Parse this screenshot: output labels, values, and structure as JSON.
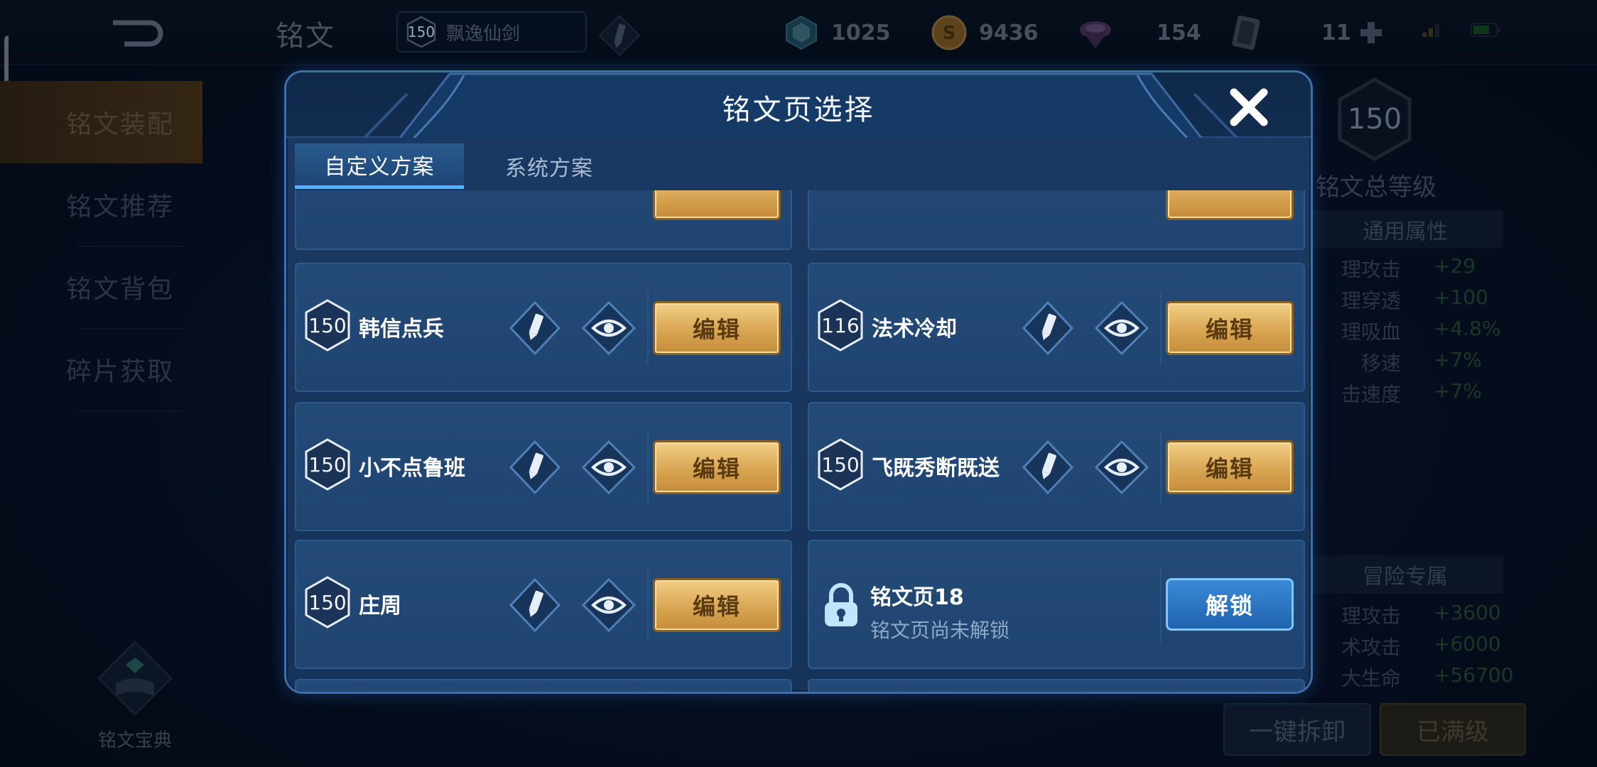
{
  "app": {
    "page_title": "铭文",
    "hero_level": "150",
    "hero_name": "飘逸仙剑",
    "currencies": [
      {
        "name": "diamond",
        "icon": "diamond-icon",
        "value": "1025"
      },
      {
        "name": "gold",
        "icon": "gold-coin-icon",
        "value": "9436"
      },
      {
        "name": "crystal",
        "icon": "crystal-icon",
        "value": "154"
      },
      {
        "name": "card",
        "icon": "card-icon",
        "value": "11"
      }
    ]
  },
  "sidebar": {
    "items": [
      {
        "label": "铭文装配",
        "active": true
      },
      {
        "label": "铭文推荐",
        "active": false
      },
      {
        "label": "铭文背包",
        "active": false
      },
      {
        "label": "碎片获取",
        "active": false
      }
    ],
    "codex_label": "铭文宝典"
  },
  "right_panel": {
    "total_level": "150",
    "total_level_label": "铭文总等级",
    "common_header": "通用属性",
    "common_attrs": [
      {
        "key": "理攻击",
        "value": "+29"
      },
      {
        "key": "理穿透",
        "value": "+100"
      },
      {
        "key": "理吸血",
        "value": "+4.8%"
      },
      {
        "key": "移速",
        "value": "+7%"
      },
      {
        "key": "击速度",
        "value": "+7%"
      }
    ],
    "adventure_header": "冒险专属",
    "adventure_attrs": [
      {
        "key": "理攻击",
        "value": "+3600"
      },
      {
        "key": "术攻击",
        "value": "+6000"
      },
      {
        "key": "大生命",
        "value": "+56700"
      }
    ],
    "dismantle_label": "一键拆卸",
    "maxed_label": "已满级"
  },
  "modal": {
    "title": "铭文页选择",
    "tabs": [
      {
        "label": "自定义方案",
        "active": true
      },
      {
        "label": "系统方案",
        "active": false
      }
    ],
    "pages": [
      {
        "level": "150",
        "name": "韩信点兵",
        "edit_label": "编辑"
      },
      {
        "level": "116",
        "name": "法术冷却",
        "edit_label": "编辑"
      },
      {
        "level": "150",
        "name": "小不点鲁班",
        "edit_label": "编辑"
      },
      {
        "level": "150",
        "name": "飞既秀断既送",
        "edit_label": "编辑"
      },
      {
        "level": "150",
        "name": "庄周",
        "edit_label": "编辑"
      }
    ],
    "locked_page": {
      "name": "铭文页18",
      "subtitle": "铭文页尚未解锁",
      "unlock_label": "解锁"
    }
  },
  "colors": {
    "modal_bg": "#1b3a63",
    "gold_button": "#d9a653",
    "blue_button": "#1f63ad",
    "tab_accent": "#49b6ff",
    "positive_value": "#3b6b3e"
  }
}
